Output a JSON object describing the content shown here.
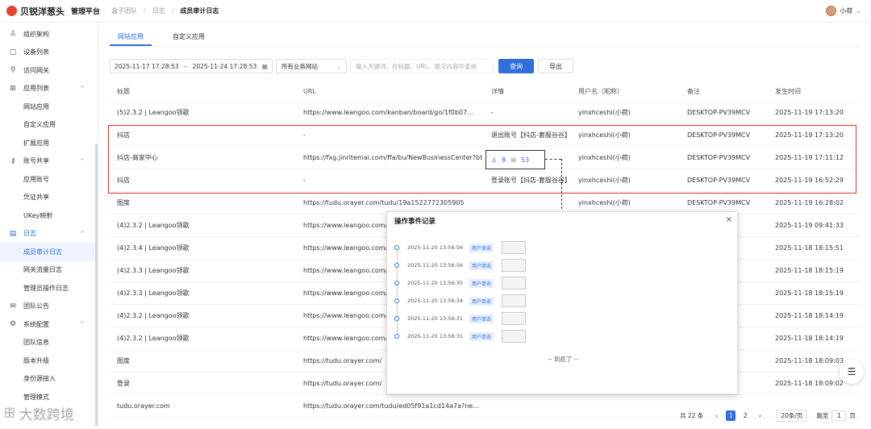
{
  "header": {
    "brand": "贝锐洋葱头",
    "platform": "管理平台",
    "breadcrumbs": [
      "盒子团队",
      "日志",
      "成员审计日志"
    ],
    "user": "小荷"
  },
  "sidebar": {
    "items": [
      {
        "label": "组织架构",
        "icon": "org-icon"
      },
      {
        "label": "设备列表",
        "icon": "device-icon"
      },
      {
        "label": "访问网关",
        "icon": "gateway-icon"
      },
      {
        "label": "应用列表",
        "icon": "apps-icon",
        "expand": "^"
      },
      {
        "label": "网站应用",
        "sub": true
      },
      {
        "label": "自定义应用",
        "sub": true
      },
      {
        "label": "扩展应用",
        "sub": true
      },
      {
        "label": "账号共享",
        "icon": "key-icon",
        "expand": "^"
      },
      {
        "label": "应用账号",
        "sub": true
      },
      {
        "label": "凭证共享",
        "sub": true
      },
      {
        "label": "UKey映射",
        "sub": true
      },
      {
        "label": "日志",
        "icon": "log-icon",
        "expand": "^"
      },
      {
        "label": "成员审计日志",
        "sub": true,
        "active": true
      },
      {
        "label": "网关流量日志",
        "sub": true
      },
      {
        "label": "管理员操作日志",
        "sub": true
      },
      {
        "label": "团队公告",
        "icon": "mail-icon"
      },
      {
        "label": "系统配置",
        "icon": "settings-icon",
        "expand": "^"
      },
      {
        "label": "团队信息",
        "sub": true
      },
      {
        "label": "版本升级",
        "sub": true
      },
      {
        "label": "身份源接入",
        "sub": true
      },
      {
        "label": "管理模式",
        "sub": true
      }
    ]
  },
  "tabs": [
    "网站应用",
    "自定义应用"
  ],
  "filters": {
    "start": "2025-11-17 17:28:53",
    "dash": "–",
    "end": "2025-11-24 17:28:53",
    "site": "所有业务网站",
    "search_placeholder": "输入关键词，在标题、URL、提交内容中查询",
    "query": "查询",
    "export": "导出"
  },
  "table": {
    "headers": [
      "标题",
      "URL",
      "详情",
      "用户名（昵称）",
      "备注",
      "发生时间"
    ],
    "rows": [
      [
        "(5)2.3.2 | Leangoo领歌",
        "https://www.leangoo.com/kanban/board/go/1f0b07…",
        "-",
        "yinxhceshi(小荷)",
        "DESKTOP-PV39MCV",
        "2025-11-19 17:13:20"
      ],
      [
        "抖店",
        "-",
        "退出账号【抖店-套服谷谷】",
        "yinxhceshi(小荷)",
        "DESKTOP-PV39MCV",
        "2025-11-19 17:13:20"
      ],
      [
        "抖店-商家中心",
        "https://fxg.jinritemai.com/ffa/bu/NewBusinessCenter?btm_…",
        "",
        "yinxhceshi(小荷)",
        "DESKTOP-PV39MCV",
        "2025-11-19 17:11:12"
      ],
      [
        "抖店",
        "-",
        "登录账号【抖店-套服谷谷】",
        "yinxhceshi(小荷)",
        "DESKTOP-PV39MCV",
        "2025-11-19 16:52:29"
      ],
      [
        "图度",
        "https://tudu.orayer.com/tudu/19a1522772305905",
        "",
        "yinxhceshi(小荷)",
        "DESKTOP-PV39MCV",
        "2025-11-19 16:28:02"
      ],
      [
        "(4)2.3.2 | Leangoo领歌",
        "https://www.leangoo.com/",
        "",
        "",
        "",
        "2025-11-19 09:41:33"
      ],
      [
        "(4)2.3.4 | Leangoo领歌",
        "https://www.leangoo.com/",
        "",
        "",
        "",
        "2025-11-18 18:15:51"
      ],
      [
        "(4)2.3.3 | Leangoo领歌",
        "https://www.leangoo.com/",
        "",
        "",
        "",
        "2025-11-18 18:15:19"
      ],
      [
        "(4)2.3.3 | Leangoo领歌",
        "https://www.leangoo.com/",
        "",
        "",
        "",
        "2025-11-18 18:15:19"
      ],
      [
        "(4)2.3.2 | Leangoo领歌",
        "https://www.leangoo.com/",
        "",
        "",
        "",
        "2025-11-18 18:14:19"
      ],
      [
        "(4)2.3.2 | Leangoo领歌",
        "https://www.leangoo.com/",
        "",
        "",
        "",
        "2025-11-18 18:14:19"
      ],
      [
        "图度",
        "https://tudu.orayer.com/",
        "",
        "",
        "",
        "2025-11-18 18:09:03"
      ],
      [
        "登录",
        "https://tudu.orayer.com/",
        "",
        "",
        "",
        "2025-11-18 18:09:02"
      ],
      [
        "tudu.orayer.com",
        "https://tudu.orayer.com/tudu/ed05f91a1cd14a7a?ne…",
        "",
        "",
        "",
        ""
      ]
    ],
    "detail_counts": {
      "left": "8",
      "right": "53"
    }
  },
  "modal": {
    "title": "操作事件记录",
    "close": "×",
    "events": [
      {
        "time": "2025-11-20 13:56:56",
        "tag": "用户单击"
      },
      {
        "time": "2025-11-20 13:56:56",
        "tag": "用户单击"
      },
      {
        "time": "2025-11-20 13:56:35",
        "tag": "用户单击"
      },
      {
        "time": "2025-11-20 13:56:34",
        "tag": "用户单击"
      },
      {
        "time": "2025-11-20 13:56:31",
        "tag": "用户单击"
      },
      {
        "time": "2025-11-20 13:56:31",
        "tag": "用户单击"
      }
    ],
    "end_text": "-- 到底了 --"
  },
  "pager": {
    "total": "共 22 条",
    "pages": [
      "1",
      "2"
    ],
    "size": "20条/页",
    "jump_label": "跳至",
    "jump_value": "1",
    "page_label": "页"
  },
  "watermark": "大数跨境",
  "colors": {
    "accent": "#2f6fde",
    "highlight": "#d9342c",
    "brand": "#e8412f"
  }
}
